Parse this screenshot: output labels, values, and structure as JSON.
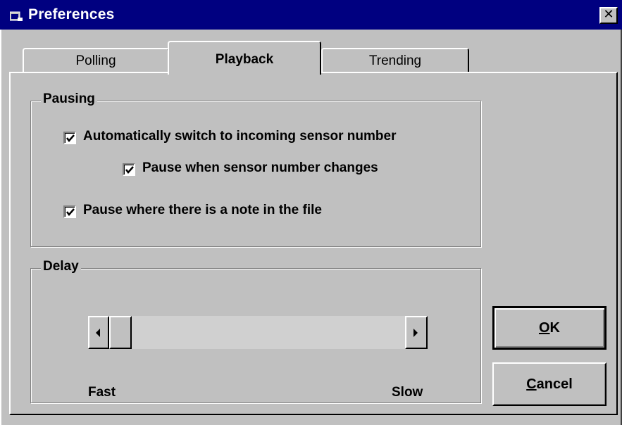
{
  "window": {
    "title": "Preferences",
    "close_glyph": "✕"
  },
  "tabs": [
    {
      "label": "Polling",
      "active": false
    },
    {
      "label": "Playback",
      "active": true
    },
    {
      "label": "Trending",
      "active": false
    }
  ],
  "pausing": {
    "label": "Pausing",
    "options": [
      {
        "label": "Automatically switch to incoming sensor number",
        "checked": true
      },
      {
        "label": "Pause when sensor number changes",
        "checked": true
      },
      {
        "label": "Pause where there is a note in the file",
        "checked": true
      }
    ]
  },
  "delay": {
    "label": "Delay",
    "min_label": "Fast",
    "max_label": "Slow",
    "slider_position": 0
  },
  "buttons": {
    "ok": {
      "mnemonic": "O",
      "rest": "K"
    },
    "cancel": {
      "mnemonic": "C",
      "rest": "ancel"
    }
  },
  "colors": {
    "titlebar": "#000080",
    "face": "#c0c0c0"
  },
  "icons": {
    "title": "app-window-icon",
    "close": "close-icon",
    "check": "checkmark-icon",
    "scroll_left": "left-arrow-icon",
    "scroll_right": "right-arrow-icon"
  }
}
